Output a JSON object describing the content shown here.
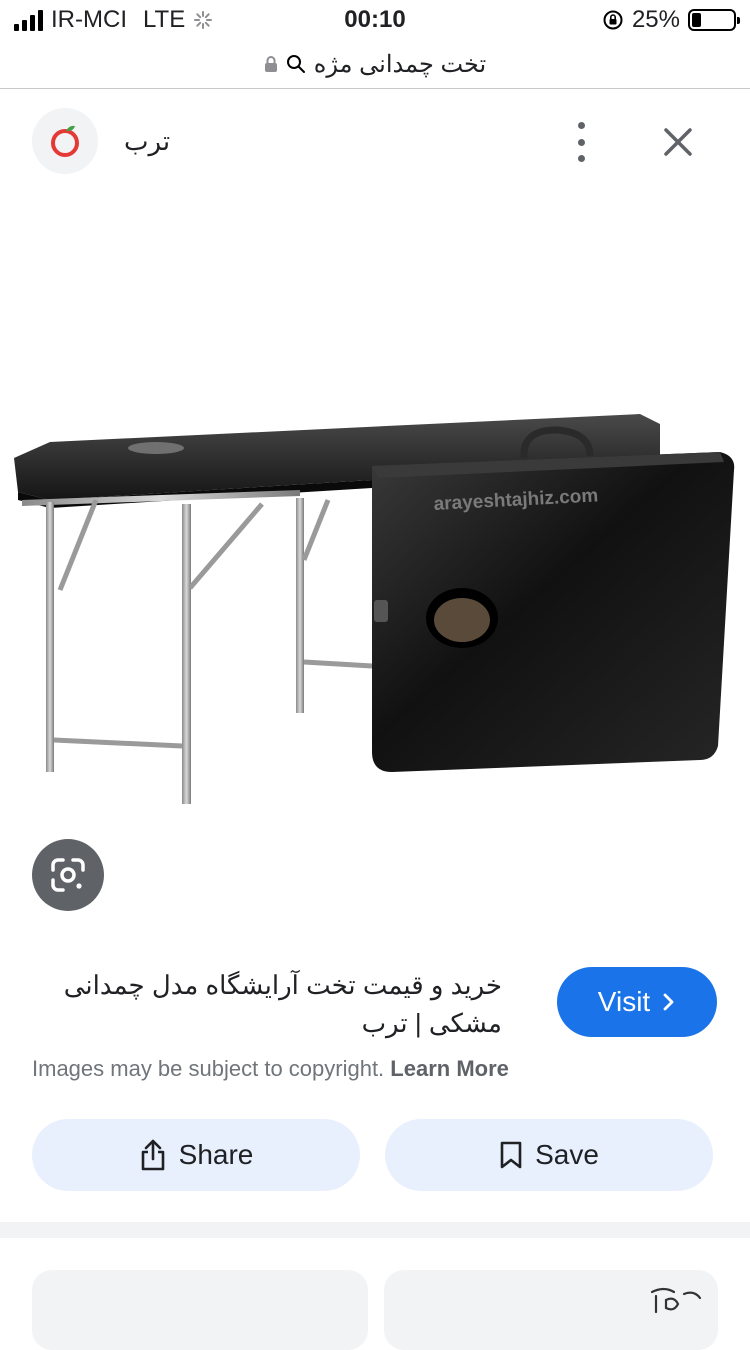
{
  "status_bar": {
    "carrier": "IR-MCI",
    "network": "LTE",
    "time": "00:10",
    "battery": "25%",
    "battery_level": 0.25
  },
  "url_bar": {
    "query": "تخت چمدانی مژه"
  },
  "header": {
    "site_name": "ترب",
    "brand_color": "#e53935"
  },
  "image": {
    "watermark": "arayeshtajhiz.com"
  },
  "result": {
    "title": "خرید و قیمت تخت آرایشگاه مدل چمدانی مشکی | ترب",
    "visit_label": "Visit"
  },
  "copyright": {
    "text": "Images may be subject to copyright.",
    "link": "Learn More"
  },
  "actions": {
    "share_label": "Share",
    "save_label": "Save"
  },
  "colors": {
    "visit": "#1a73e8",
    "action_bg": "#e8f0fe",
    "lens_bg": "#5f6368"
  },
  "icons": [
    "lock-icon",
    "search-icon",
    "torob-logo",
    "more-vert-icon",
    "close-icon",
    "google-lens-icon",
    "chevron-right-icon",
    "share-icon",
    "bookmark-icon"
  ]
}
